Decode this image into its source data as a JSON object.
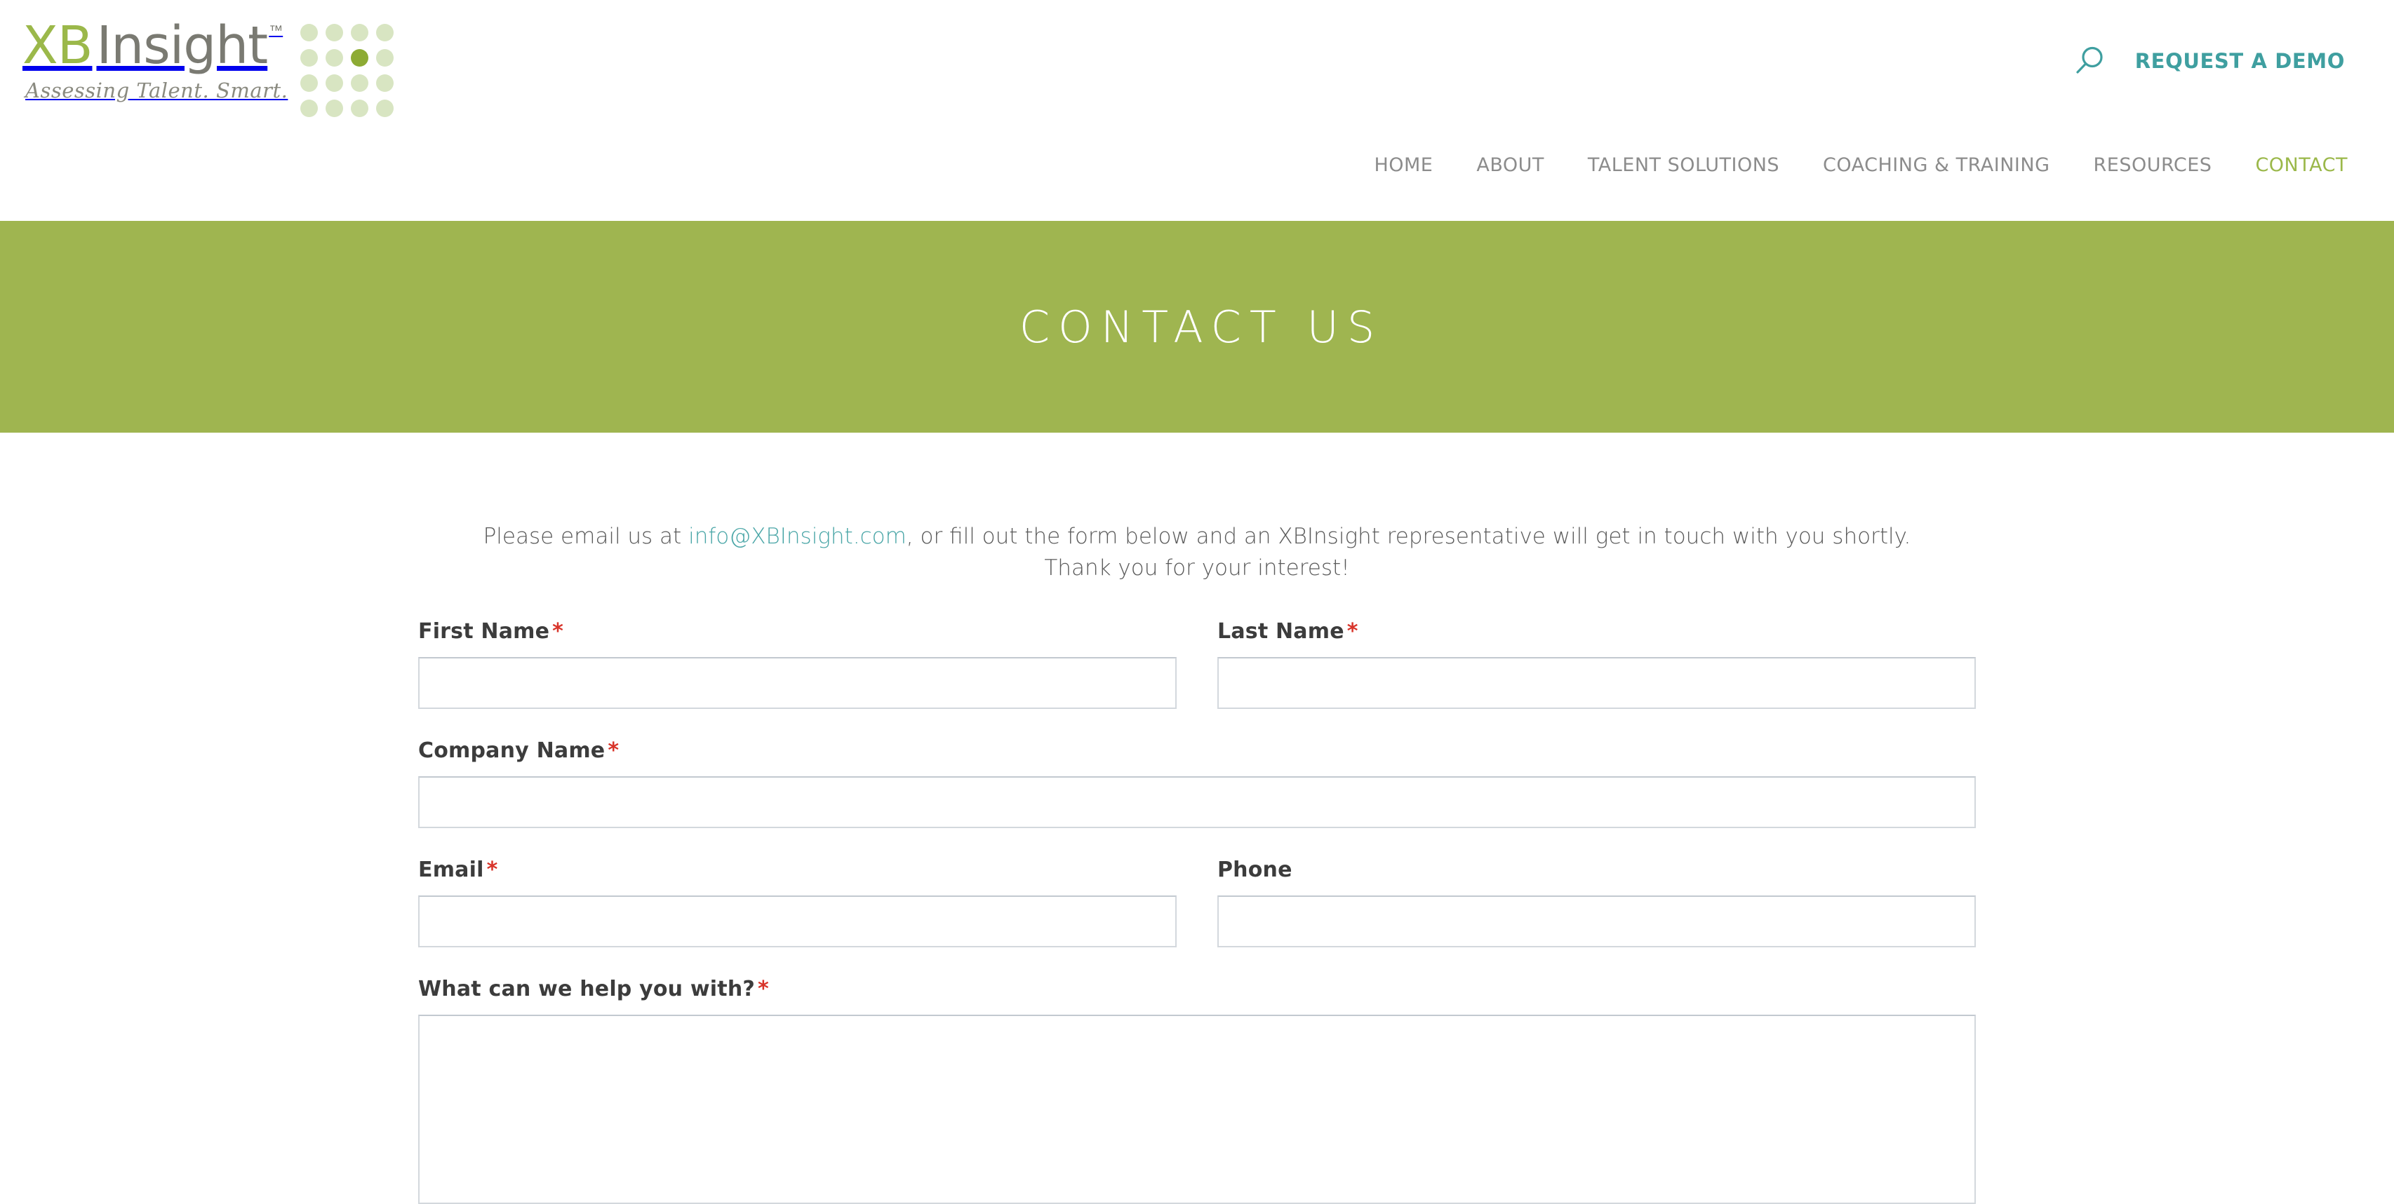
{
  "header": {
    "logo": {
      "brand_first": "XB",
      "brand_second": "Insight",
      "trademark": "™",
      "tagline": "Assessing Talent. Smart.",
      "brand_green": "#9bb84a",
      "brand_gray": "#7a7a72",
      "dot_light": "#d8e5c2",
      "dot_accent": "#8dab34"
    },
    "search_icon": "search-icon",
    "request_demo_label": "REQUEST A DEMO",
    "accent_teal": "#3f9fa0",
    "nav": [
      {
        "label": "HOME",
        "active": false
      },
      {
        "label": "ABOUT",
        "active": false
      },
      {
        "label": "TALENT SOLUTIONS",
        "active": false
      },
      {
        "label": "COACHING & TRAINING",
        "active": false
      },
      {
        "label": "RESOURCES",
        "active": false
      },
      {
        "label": "CONTACT",
        "active": true
      }
    ]
  },
  "banner": {
    "title": "CONTACT US",
    "background_color": "#9fb550",
    "text_color": "#ffffff"
  },
  "content": {
    "intro": {
      "before_link": "Please email us at ",
      "link_text": "info@XBInsight.com",
      "after_link": ", or fill out the form below and an XBInsight representative will get in touch with you shortly.",
      "second_line": "Thank you for your interest!",
      "link_color": "#4aa6a7"
    },
    "form": {
      "required_marker": "*",
      "fields": {
        "first_name": {
          "label": "First Name",
          "required": true,
          "value": "",
          "placeholder": ""
        },
        "last_name": {
          "label": "Last Name",
          "required": true,
          "value": "",
          "placeholder": ""
        },
        "company_name": {
          "label": "Company Name",
          "required": true,
          "value": "",
          "placeholder": ""
        },
        "email": {
          "label": "Email",
          "required": true,
          "value": "",
          "placeholder": ""
        },
        "phone": {
          "label": "Phone",
          "required": false,
          "value": "",
          "placeholder": ""
        },
        "message": {
          "label": "What can we help you with?",
          "required": true,
          "value": "",
          "placeholder": ""
        }
      }
    }
  }
}
